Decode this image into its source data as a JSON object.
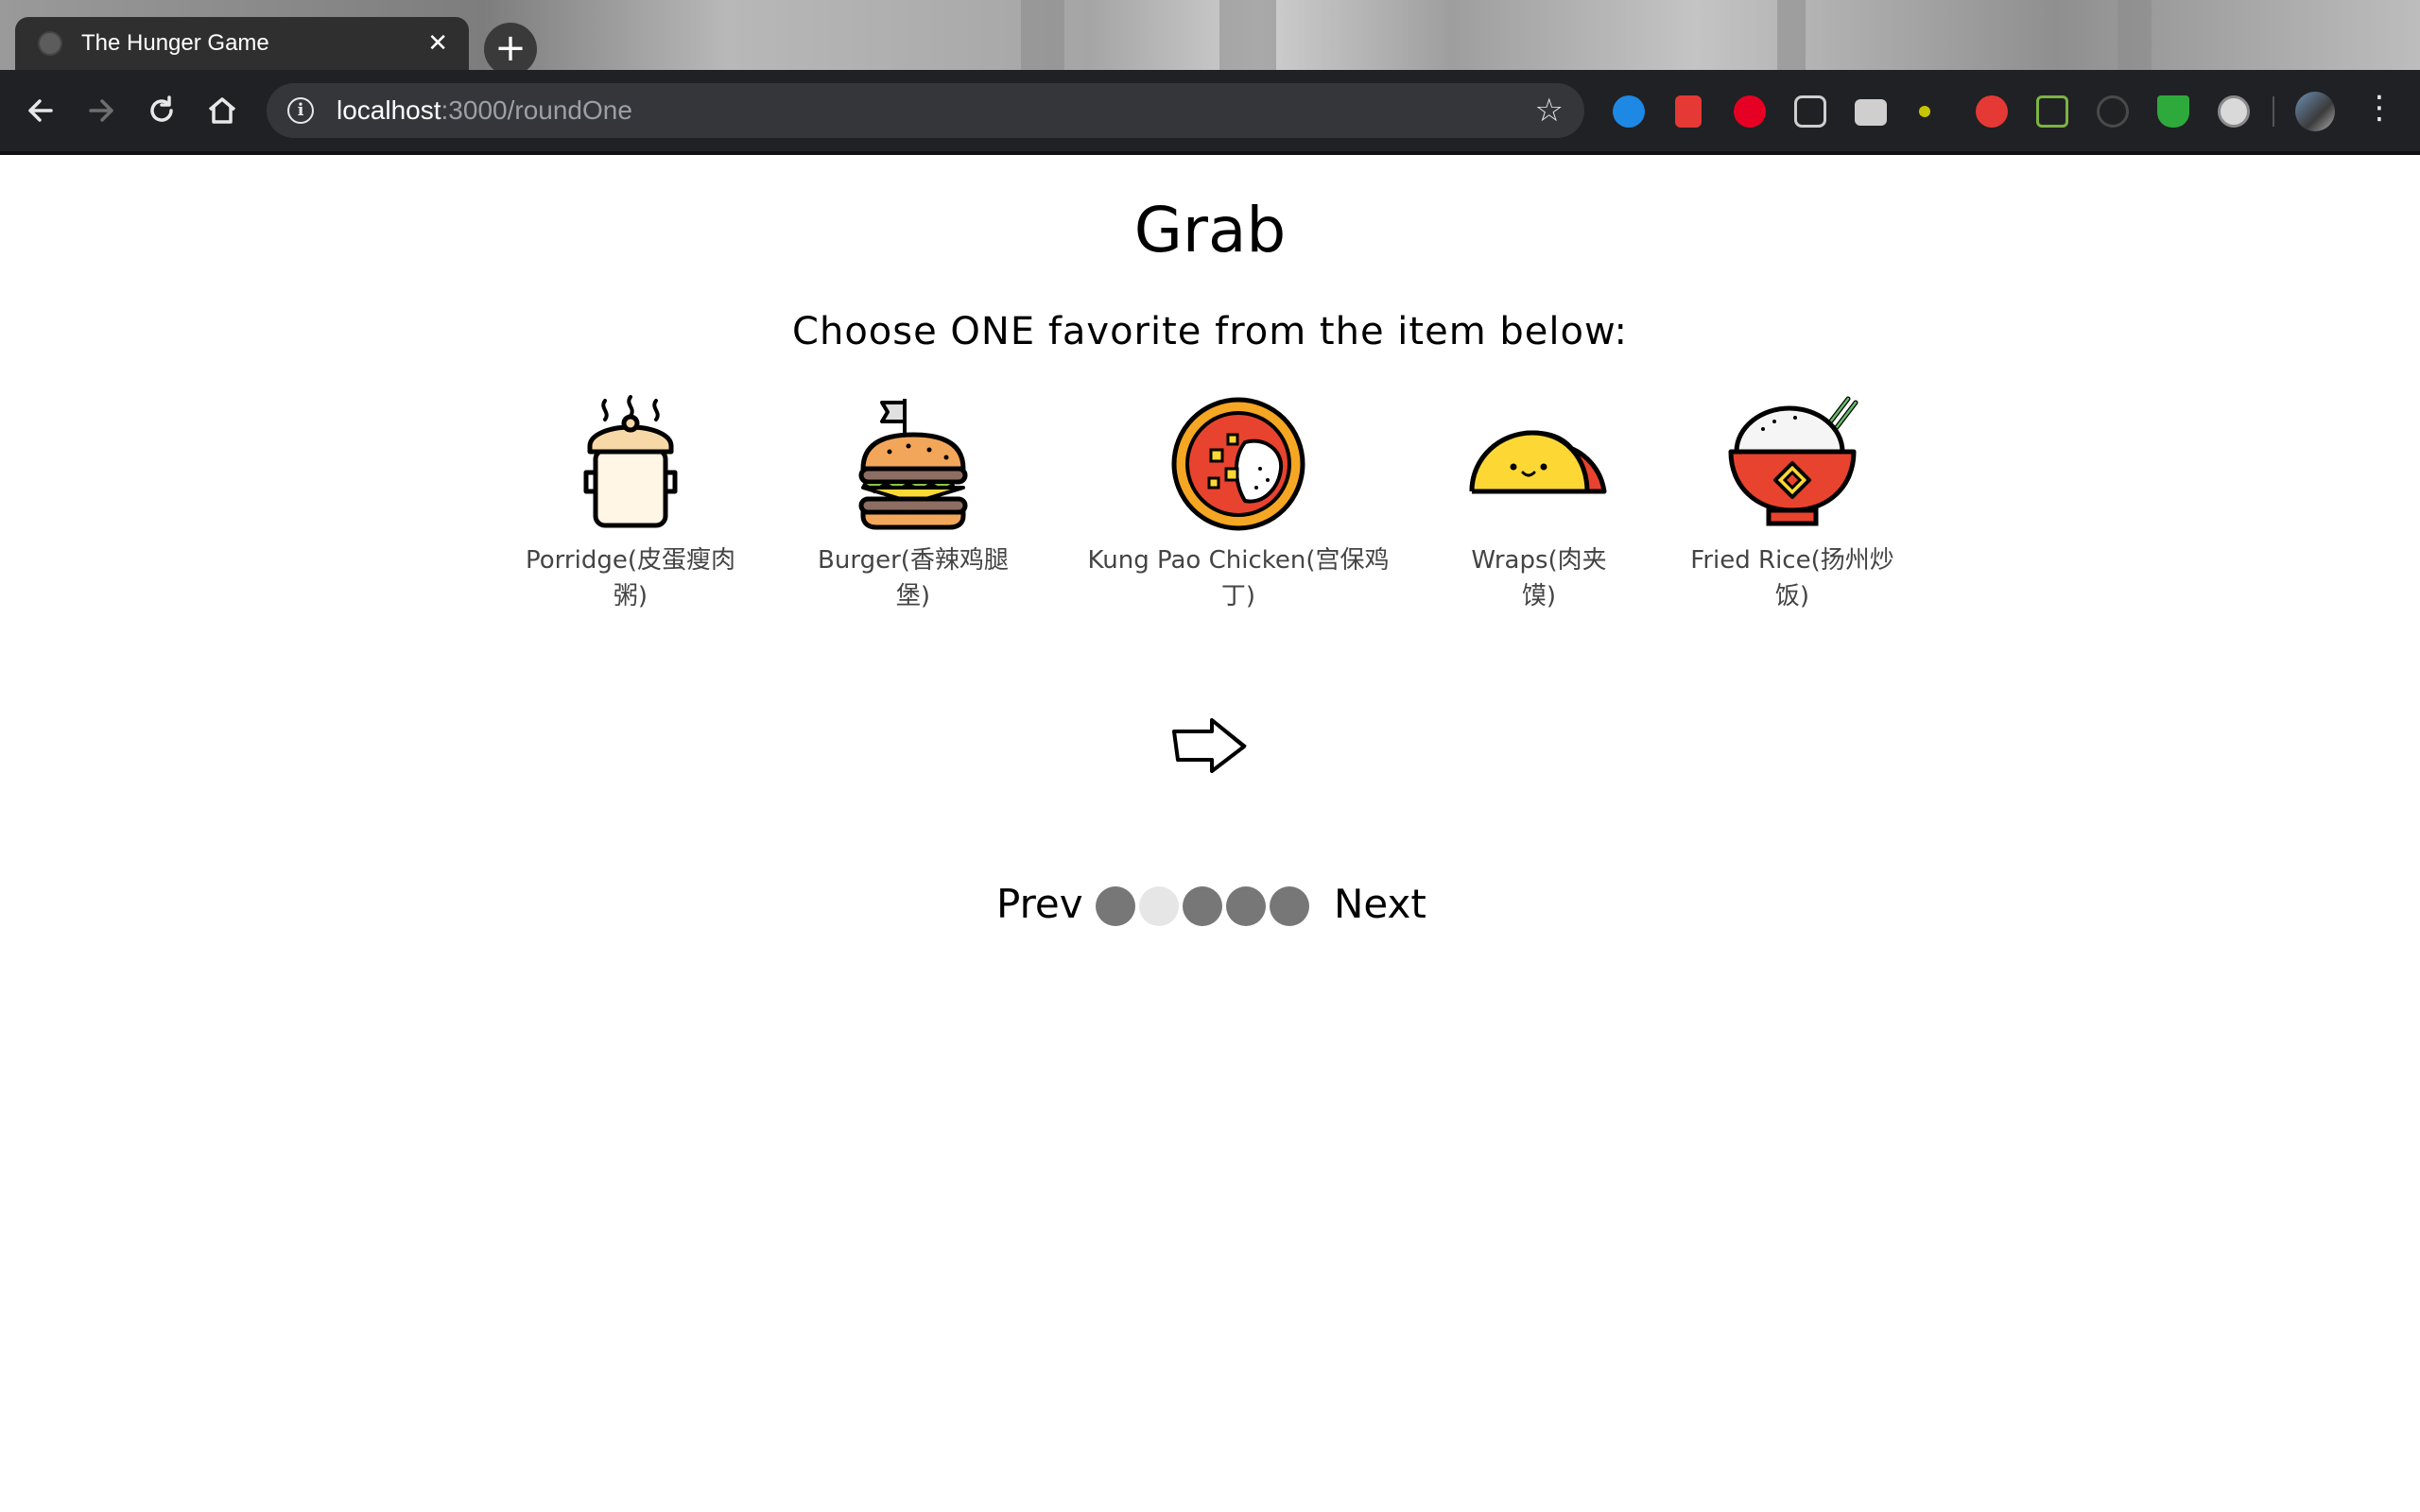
{
  "browser": {
    "tab_title": "The Hunger Game",
    "close_glyph": "✕",
    "new_tab_glyph": "+",
    "url_host": "localhost",
    "url_path": ":3000/roundOne",
    "extensions": [
      "bank-extension-icon",
      "bookmark-extension-icon",
      "pinterest-icon",
      "pocket-icon",
      "camera-icon",
      "lightbulb-icon",
      "adblock-icon",
      "nodejs-icon",
      "stopwatch-icon",
      "shield-icon",
      "circle-extension-icon",
      "profile-avatar"
    ]
  },
  "page": {
    "title": "Grab",
    "instruction": "Choose ONE favorite from the item below:",
    "items": [
      {
        "label_line1": "Porridge(皮蛋瘦肉",
        "label_line2": "粥)",
        "icon": "cooking-pot-icon"
      },
      {
        "label_line1": "Burger(香辣鸡腿",
        "label_line2": "堡)",
        "icon": "burger-icon"
      },
      {
        "label_line1": "Kung Pao Chicken(宫保鸡",
        "label_line2": "丁)",
        "icon": "kung-pao-plate-icon"
      },
      {
        "label_line1": "Wraps(肉夹",
        "label_line2": "馍)",
        "icon": "taco-wrap-icon"
      },
      {
        "label_line1": "Fried Rice(扬州炒",
        "label_line2": "饭)",
        "icon": "rice-bowl-icon"
      }
    ],
    "pager": {
      "prev_label": "Prev",
      "next_label": "Next",
      "current_page": 2,
      "total_pages": 5
    }
  },
  "colors": {
    "dot_inactive": "#777777",
    "dot_active": "#e6e6e6",
    "label_text": "#444444"
  }
}
